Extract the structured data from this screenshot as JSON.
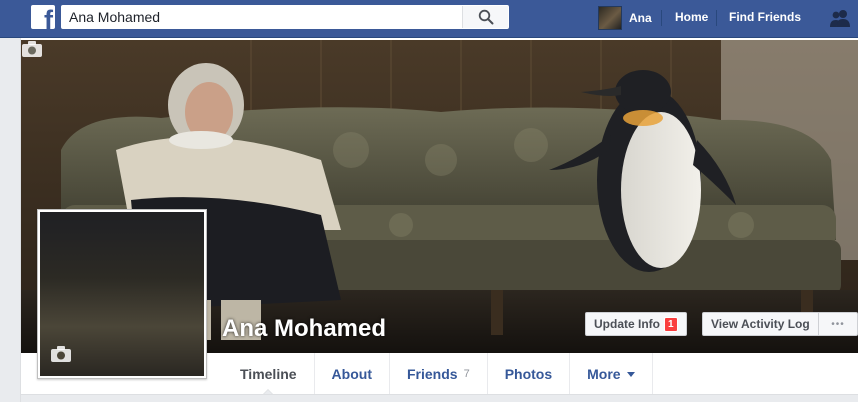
{
  "topbar": {
    "logo": "f",
    "search": {
      "value": "Ana Mohamed",
      "icon": "search-icon"
    },
    "user_name": "Ana",
    "home_label": "Home",
    "find_friends_label": "Find Friends",
    "friend_requests_icon": "friend-requests-icon",
    "brand_color": "#3b5998"
  },
  "profile": {
    "name": "Ana Mohamed",
    "update_info_label": "Update Info",
    "update_info_badge": "1",
    "view_activity_log_label": "View Activity Log",
    "more_options_label": "•••"
  },
  "tabs": [
    {
      "label": "Timeline",
      "active": true
    },
    {
      "label": "About"
    },
    {
      "label": "Friends",
      "count": "7"
    },
    {
      "label": "Photos"
    },
    {
      "label": "More",
      "dropdown": true
    }
  ]
}
